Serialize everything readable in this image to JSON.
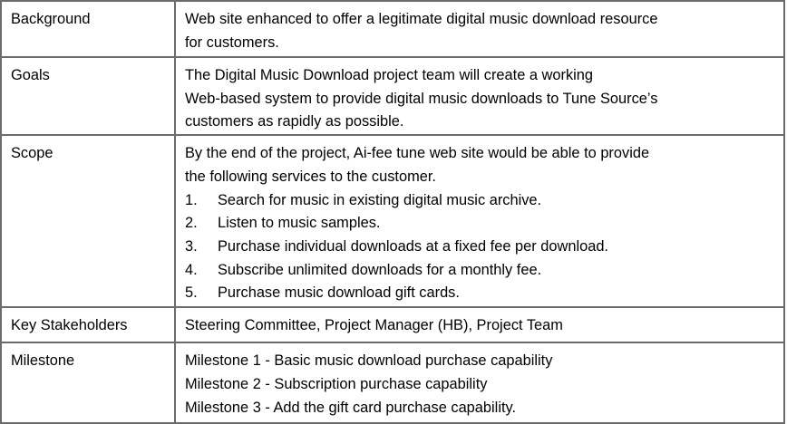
{
  "rows": [
    {
      "label": "Background",
      "lines": [
        "Web site enhanced  to offer a legitimate digital music download resource",
        "for customers."
      ]
    },
    {
      "label": "Goals",
      "lines": [
        "The Digital Music Download project team will create a working",
        "Web-based system to provide digital music downloads to Tune Source’s",
        "customers as rapidly as possible."
      ]
    },
    {
      "label": "Scope",
      "lines": [
        "By the end of the project, Ai-fee tune web site would be able to provide",
        "the following services to the customer."
      ],
      "items": [
        {
          "num": "1.",
          "text": "Search for music in existing digital music archive."
        },
        {
          "num": "2.",
          "text": "Listen to music samples."
        },
        {
          "num": "3.",
          "text": "Purchase individual downloads at a fixed fee per download."
        },
        {
          "num": "4.",
          "text": "Subscribe unlimited downloads for a monthly fee."
        },
        {
          "num": "5.",
          "text": "Purchase music download gift cards."
        }
      ]
    },
    {
      "label": "Key Stakeholders",
      "lines": [
        "Steering Committee, Project Manager (HB), Project Team"
      ]
    },
    {
      "label": "Milestone",
      "lines": [
        "Milestone 1 - Basic music download purchase capability",
        "Milestone 2 - Subscription purchase capability",
        "Milestone 3 - Add the gift card purchase capability."
      ]
    }
  ]
}
